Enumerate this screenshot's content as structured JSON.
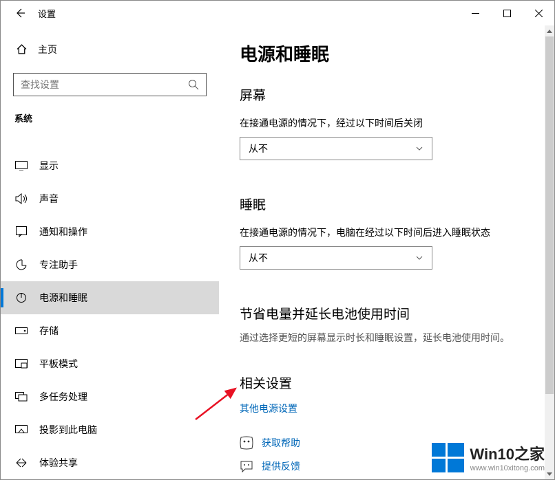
{
  "titlebar": {
    "title": "设置"
  },
  "sidebar": {
    "home": "主页",
    "search_placeholder": "查找设置",
    "category": "系统",
    "items": [
      {
        "label": "显示"
      },
      {
        "label": "声音"
      },
      {
        "label": "通知和操作"
      },
      {
        "label": "专注助手"
      },
      {
        "label": "电源和睡眠"
      },
      {
        "label": "存储"
      },
      {
        "label": "平板模式"
      },
      {
        "label": "多任务处理"
      },
      {
        "label": "投影到此电脑"
      },
      {
        "label": "体验共享"
      }
    ]
  },
  "main": {
    "title": "电源和睡眠",
    "screen": {
      "heading": "屏幕",
      "label": "在接通电源的情况下，经过以下时间后关闭",
      "value": "从不"
    },
    "sleep": {
      "heading": "睡眠",
      "label": "在接通电源的情况下，电脑在经过以下时间后进入睡眠状态",
      "value": "从不"
    },
    "save": {
      "heading": "节省电量并延长电池使用时间",
      "desc": "通过选择更短的屏幕显示时长和睡眠设置，延长电池使用时间。"
    },
    "related": {
      "heading": "相关设置",
      "link": "其他电源设置"
    },
    "help": "获取帮助",
    "feedback": "提供反馈"
  },
  "watermark": {
    "text": "Win10之家",
    "url": "www.win10xitong.com"
  }
}
